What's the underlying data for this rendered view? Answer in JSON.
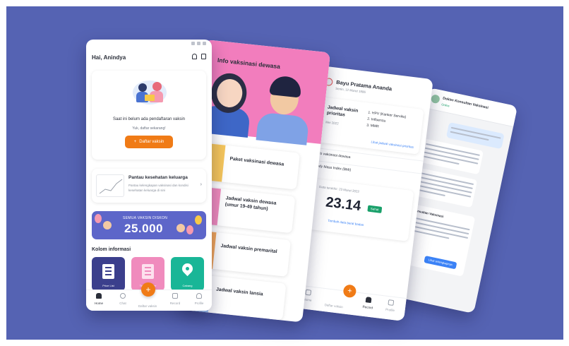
{
  "app": {
    "greeting": "Hai, Anindya",
    "vaccine_card": {
      "message": "Saat ini belum ada pendaftaran vaksin",
      "subtext": "Yuk, daftar sekarang!",
      "button_label": "Daftar vaksin"
    },
    "health_card": {
      "title": "Pantau kesehatan keluarga",
      "subtitle": "Pantau kelengkapan vaksinasi dan kondisi kesehatan keluarga di sini"
    },
    "promo": {
      "top_text": "SEMUA VAKSIN DISKON",
      "amount": "25.000"
    },
    "info_section": {
      "title": "Kolom informasi",
      "tiles": [
        {
          "label": "Price List",
          "color": "#3b3f8c",
          "icon": "price-list-icon"
        },
        {
          "label": "Tanya Dokter",
          "color": "#f08bbd",
          "icon": "document-icon"
        },
        {
          "label": "Cabang",
          "color": "#19b697",
          "icon": "location-pin-icon"
        }
      ]
    },
    "tabbar": [
      "Home",
      "Chat",
      "Daftar vaksin",
      "Record",
      "Profile"
    ]
  },
  "info_screen": {
    "title": "Info vaksinasi dewasa",
    "cards": [
      "Paket vaksinasi dewasa",
      "Jadwal vaksin dewasa (umur 19-49 tahun)",
      "Jadwal vaksin premarital",
      "Jadwal vaksin lansia"
    ],
    "colors": [
      "#f6c65b",
      "#f08bbd",
      "#f2a65a",
      "#9fc3f5"
    ]
  },
  "record_screen": {
    "name": "Bayu Pratama Ananda",
    "dob": "Senin, 12 Maret 1986",
    "schedule_title": "Jadwal vaksin prioritas",
    "schedule_date": "Mei 2022",
    "vaccines": [
      "1. HPV (Kanker Serviks)",
      "2. Influenza",
      "3. MMR"
    ],
    "schedule_link": "Lihat jadwal vaksinasi prioritas",
    "info_row": "Info vaksinasi dewasa",
    "bmi_row": "Body Mass Index (BMI)",
    "bmi_sub": "Data terakhir: 23 Maret 2022",
    "bmi_value": "23.14",
    "bmi_status": "Sehat",
    "add_link": "Tambah data berat badan",
    "tabbar": [
      "Home",
      "Daftar vaksin",
      "Record",
      "Profile"
    ]
  },
  "chat_screen": {
    "doctor": "Dokter Konsultan Vaksinasi",
    "status": "Online",
    "card_title": "Konsultan Vaksinasi",
    "button_label": "Lihat selengkapnya"
  }
}
